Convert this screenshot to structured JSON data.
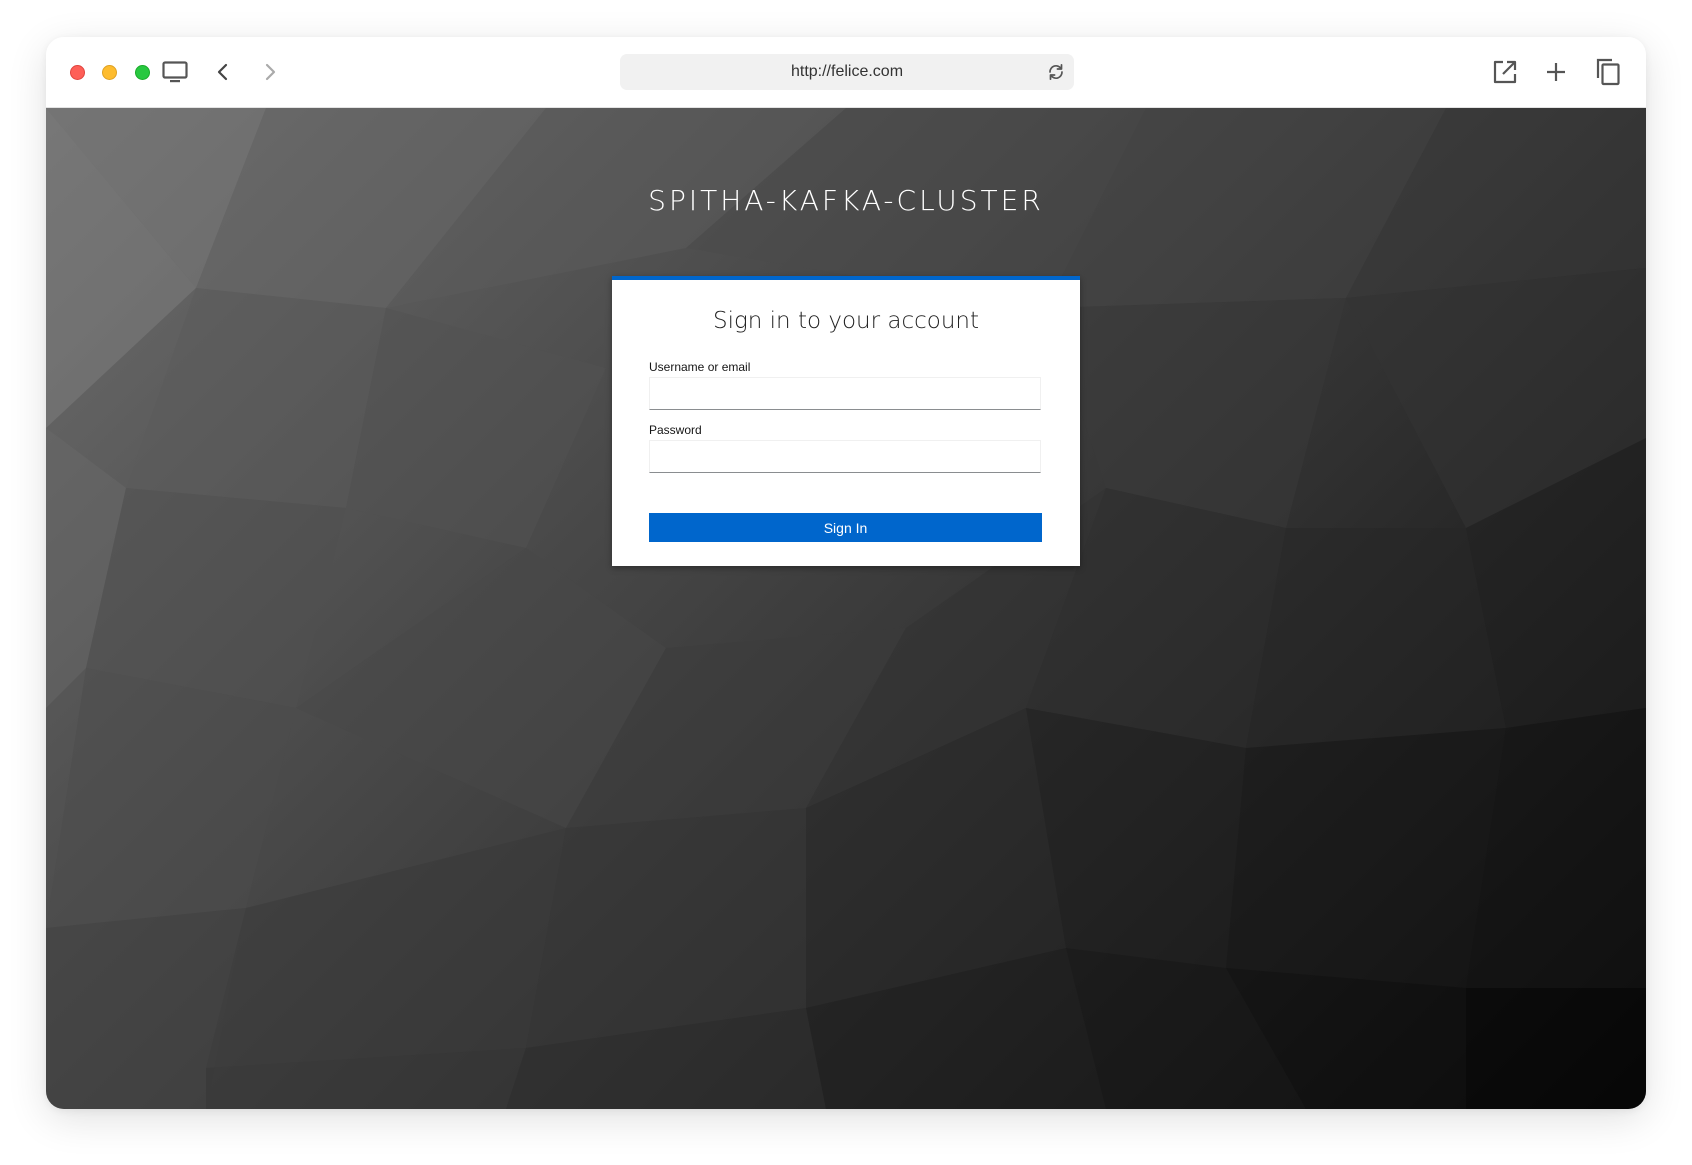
{
  "browser": {
    "url": "http://felice.com",
    "icons": {
      "close": "close-window-icon",
      "minimize": "minimize-window-icon",
      "zoom": "zoom-window-icon",
      "display": "monitor-icon",
      "back": "chevron-left-icon",
      "forward": "chevron-right-icon",
      "reload": "reload-icon",
      "open_external": "open-external-icon",
      "new_tab": "plus-icon",
      "copy": "copy-icon"
    }
  },
  "page": {
    "realm_title": "SPITHA-KAFKA-CLUSTER",
    "login": {
      "heading": "Sign in to your account",
      "username_label": "Username or email",
      "username_value": "",
      "password_label": "Password",
      "password_value": "",
      "submit_label": "Sign In"
    }
  },
  "colors": {
    "accent": "#0066cc",
    "traffic_red": "#fe5f57",
    "traffic_yellow": "#febc2e",
    "traffic_green": "#28c840"
  }
}
